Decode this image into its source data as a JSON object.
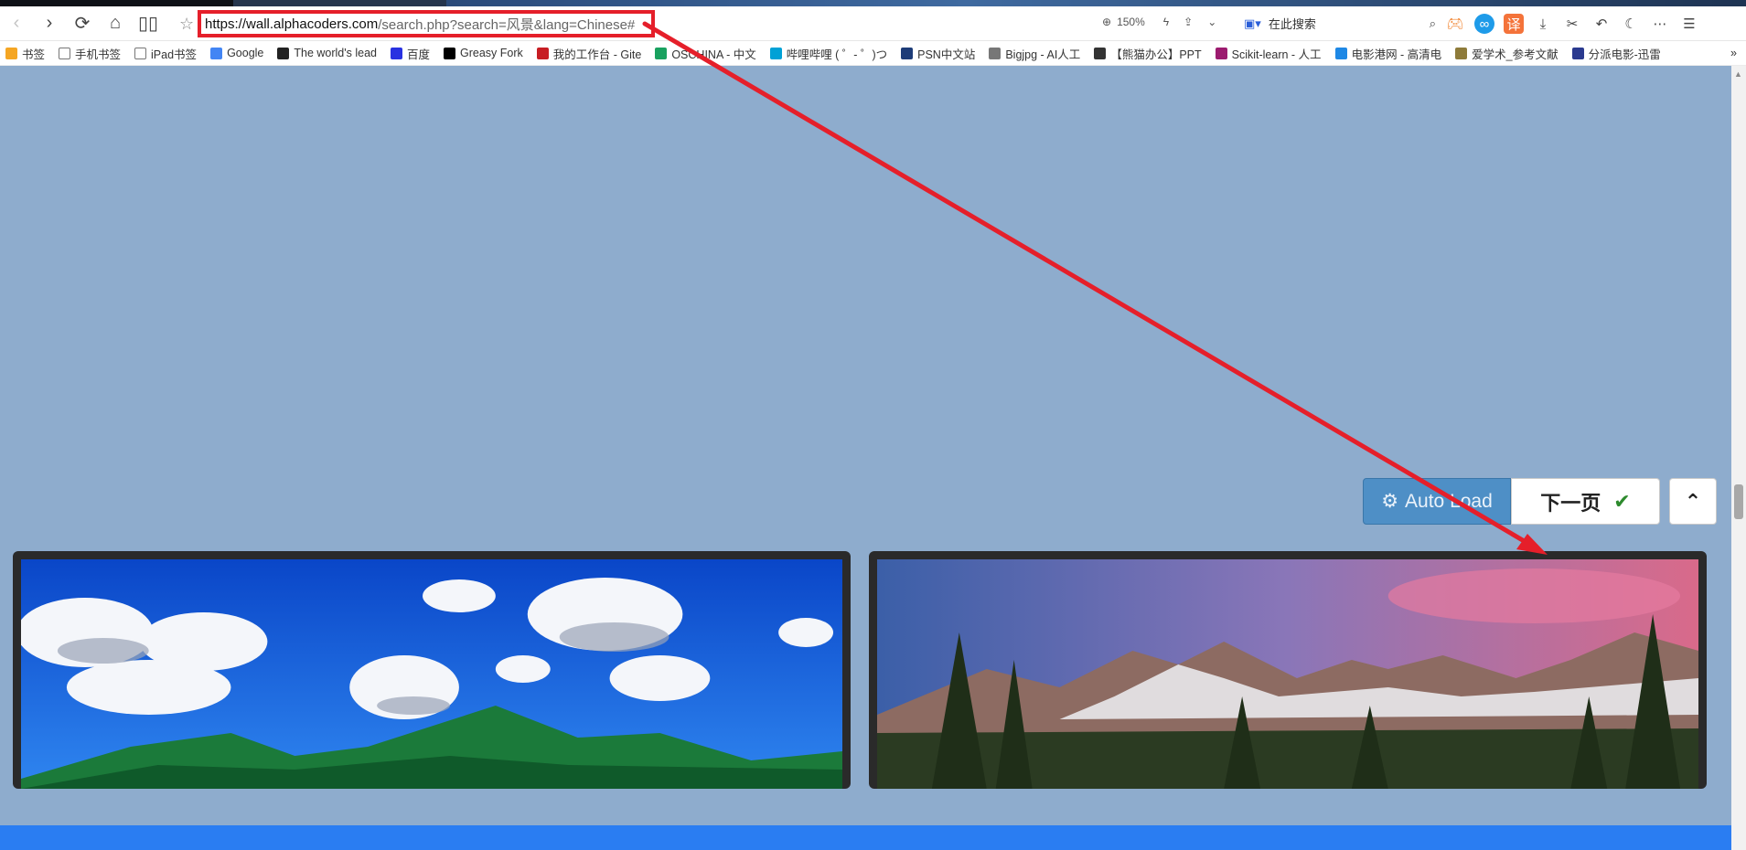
{
  "browser": {
    "url_host": "https://wall.alphacoders.com",
    "url_path": "/search.php?search=风景&lang=Chinese#",
    "zoom": "150%",
    "search_placeholder": "在此搜索"
  },
  "bookmarks": [
    {
      "label": "书签",
      "color": "#f5a623"
    },
    {
      "label": "手机书签",
      "color": "#ffffff"
    },
    {
      "label": "iPad书签",
      "color": "#ffffff"
    },
    {
      "label": "Google",
      "color": "#4285f4"
    },
    {
      "label": "The world's lead",
      "color": "#222222"
    },
    {
      "label": "百度",
      "color": "#2932e1"
    },
    {
      "label": "Greasy Fork",
      "color": "#000000"
    },
    {
      "label": "我的工作台 - Gite",
      "color": "#c71d23"
    },
    {
      "label": "OSCHINA - 中文",
      "color": "#19a15f"
    },
    {
      "label": "哔哩哔哩 ( ゜- ゜)つ",
      "color": "#00a1d6"
    },
    {
      "label": "PSN中文站",
      "color": "#1d3c78"
    },
    {
      "label": "Bigjpg - AI人工",
      "color": "#777777"
    },
    {
      "label": "【熊猫办公】PPT",
      "color": "#333333"
    },
    {
      "label": "Scikit-learn - 人工",
      "color": "#9c1b6f"
    },
    {
      "label": "电影港网 - 高清电",
      "color": "#1e88e5"
    },
    {
      "label": "爱学术_参考文献",
      "color": "#8e7b3a"
    },
    {
      "label": "分派电影-迅雷",
      "color": "#2b3a8f"
    }
  ],
  "buttons": {
    "auto_load": "Auto Load",
    "next_page": "下一页"
  },
  "colors": {
    "page_bg": "#8eaccd",
    "accent_blue": "#4e8fc6",
    "annotation_red": "#e51f2a",
    "footer_blue": "#2a7df2"
  },
  "icons": {
    "back": "chevron-left-icon",
    "forward": "chevron-right-icon",
    "reload": "reload-icon",
    "home": "home-icon",
    "reader": "book-icon",
    "star": "star-icon",
    "gear": "gear-icon",
    "check": "check-icon",
    "up": "chevron-up-icon"
  }
}
